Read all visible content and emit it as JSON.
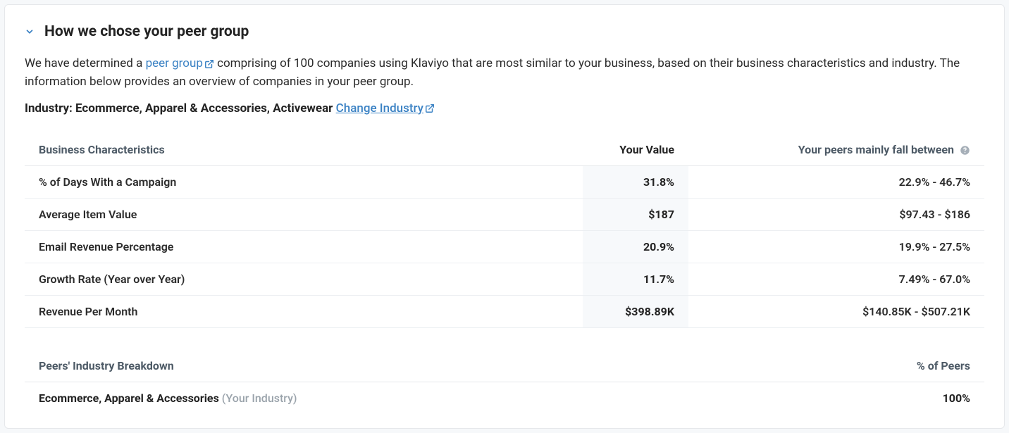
{
  "header": {
    "title": "How we chose your peer group"
  },
  "intro": {
    "prefix": "We have determined a ",
    "link_text": "peer group",
    "suffix": " comprising of 100 companies using Klaviyo that are most similar to your business, based on their business characteristics and industry. The information below provides an overview of companies in your peer group."
  },
  "industry": {
    "label": "Industry: ",
    "value": "Ecommerce, Apparel & Accessories, Activewear",
    "change_text": "Change Industry"
  },
  "table": {
    "head_characteristic": "Business Characteristics",
    "head_your_value": "Your Value",
    "head_peer_range": "Your peers mainly fall between",
    "rows": [
      {
        "label": "% of Days With a Campaign",
        "your": "31.8%",
        "peer": "22.9% - 46.7%"
      },
      {
        "label": "Average Item Value",
        "your": "$187",
        "peer": "$97.43 - $186"
      },
      {
        "label": "Email Revenue Percentage",
        "your": "20.9%",
        "peer": "19.9% - 27.5%"
      },
      {
        "label": "Growth Rate (Year over Year)",
        "your": "11.7%",
        "peer": "7.49% - 67.0%"
      },
      {
        "label": "Revenue Per Month",
        "your": "$398.89K",
        "peer": "$140.85K - $507.21K"
      }
    ]
  },
  "breakdown": {
    "head_left": "Peers' Industry Breakdown",
    "head_right": "% of Peers",
    "row_label": "Ecommerce, Apparel & Accessories",
    "row_note": "(Your Industry)",
    "row_value": "100%"
  }
}
